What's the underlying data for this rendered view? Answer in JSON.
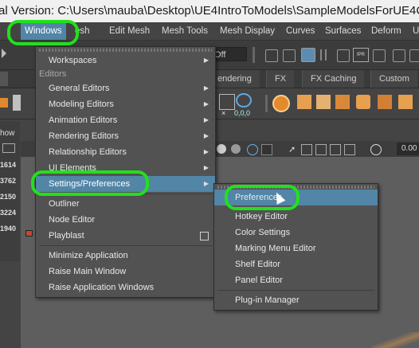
{
  "title_bar": {
    "text": "al Version: C:\\Users\\mauba\\Desktop\\UE4IntroToModels\\SampleModelsForUE4C"
  },
  "menu_bar": {
    "items": [
      "Windows",
      "esh",
      "Edit Mesh",
      "Mesh Tools",
      "Mesh Display",
      "Curves",
      "Surfaces",
      "Deform",
      "U"
    ]
  },
  "toolbar": {
    "field_value": "Off",
    "tabs": [
      "endering",
      "FX",
      "FX Caching",
      "Custom"
    ],
    "ipr_label": "IPR",
    "coords_label": "0,0,0"
  },
  "left_panel": {
    "label": "how",
    "numbers": [
      "1614",
      "3762",
      "2150",
      "3224",
      "1940"
    ]
  },
  "viewport_bar": {
    "value": "0.00"
  },
  "windows_menu": {
    "items": [
      {
        "label": "Workspaces",
        "type": "submenu"
      },
      {
        "label": "Editors",
        "type": "section"
      },
      {
        "label": "General Editors",
        "type": "submenu"
      },
      {
        "label": "Modeling Editors",
        "type": "submenu"
      },
      {
        "label": "Animation Editors",
        "type": "submenu"
      },
      {
        "label": "Rendering Editors",
        "type": "submenu"
      },
      {
        "label": "Relationship Editors",
        "type": "submenu"
      },
      {
        "label": "UI Elements",
        "type": "submenu"
      },
      {
        "label": "Settings/Preferences",
        "type": "submenu",
        "highlighted": true
      },
      {
        "label": "Outliner",
        "type": "item"
      },
      {
        "label": "Node Editor",
        "type": "item"
      },
      {
        "label": "Playblast",
        "type": "item",
        "option_box": true
      },
      {
        "label": "Minimize Application",
        "type": "item"
      },
      {
        "label": "Raise Main Window",
        "type": "item"
      },
      {
        "label": "Raise Application Windows",
        "type": "item"
      }
    ]
  },
  "settings_submenu": {
    "items": [
      {
        "label": "Preferences",
        "highlighted": true
      },
      {
        "label": "Hotkey Editor"
      },
      {
        "label": "Color Settings"
      },
      {
        "label": "Marking Menu Editor"
      },
      {
        "label": "Shelf Editor"
      },
      {
        "label": "Panel Editor"
      },
      {
        "label": "Plug-in Manager"
      }
    ]
  },
  "colors": {
    "highlight": "#5285a6",
    "annotation": "#22e01d",
    "menu_bg": "#525252"
  }
}
